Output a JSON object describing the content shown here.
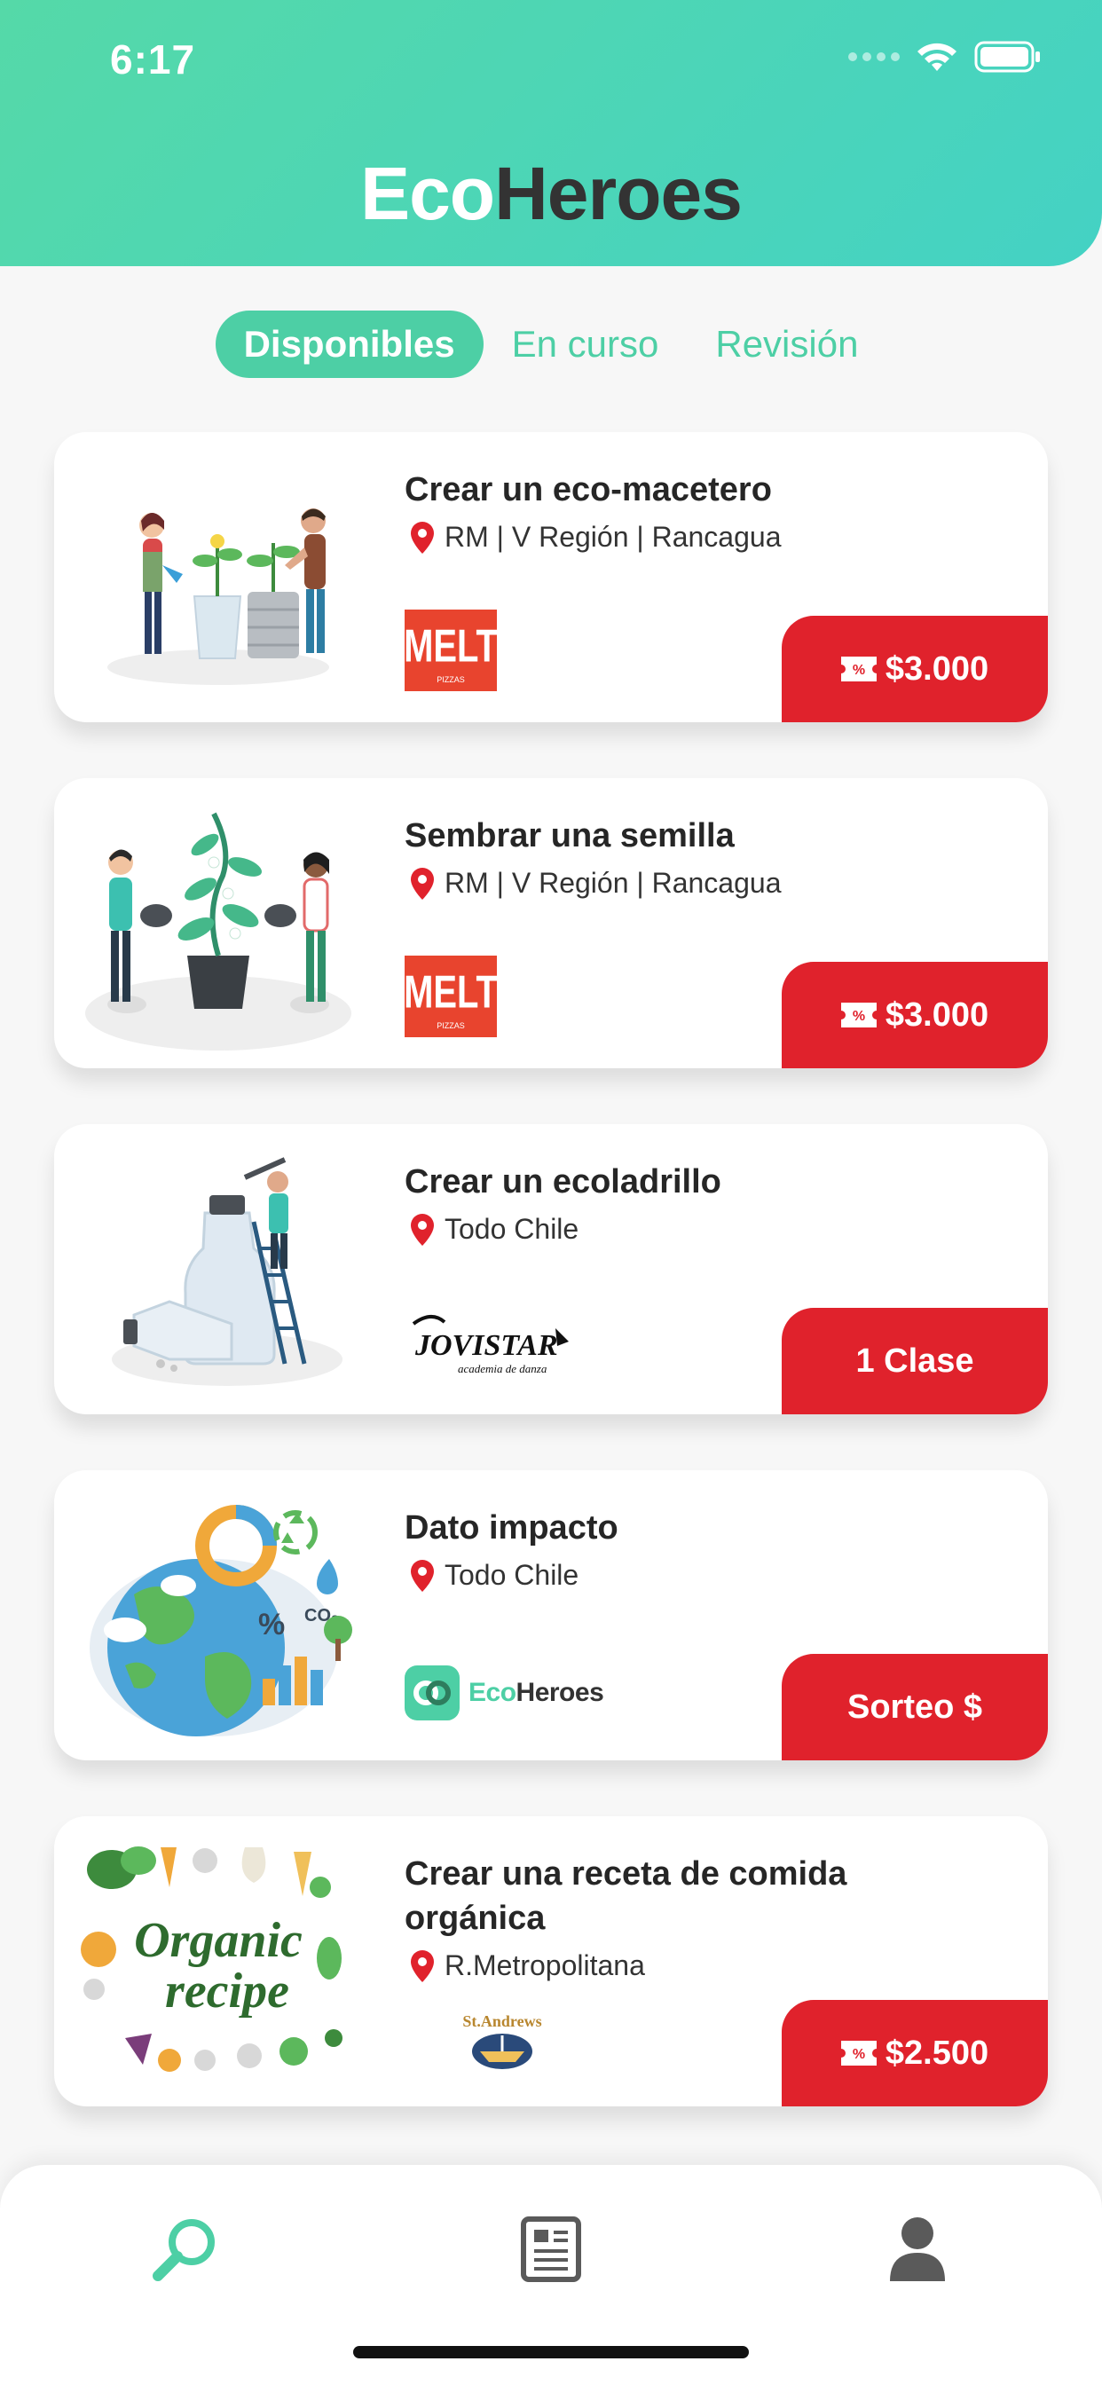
{
  "status_bar": {
    "time": "6:17"
  },
  "header": {
    "title_part1": "Eco",
    "title_part2": "Heroes"
  },
  "tabs": [
    {
      "label": "Disponibles",
      "active": true
    },
    {
      "label": "En curso",
      "active": false
    },
    {
      "label": "Revisión",
      "active": false
    }
  ],
  "cards": [
    {
      "title": "Crear un eco-macetero",
      "location": "RM | V Región | Rancagua",
      "brand": "MELT",
      "brand_sub": "PIZZAS",
      "reward": "$3.000",
      "reward_icon": "discount-ticket-icon",
      "illustration": "planting-pots-illustration"
    },
    {
      "title": "Sembrar una semilla",
      "location": "RM | V Región | Rancagua",
      "brand": "MELT",
      "brand_sub": "PIZZAS",
      "reward": "$3.000",
      "reward_icon": "discount-ticket-icon",
      "illustration": "growing-plant-illustration"
    },
    {
      "title": "Crear un ecoladrillo",
      "location": "Todo Chile",
      "brand": "JOVISTAR",
      "brand_sub": "academia de danza",
      "reward": "1 Clase",
      "illustration": "eco-brick-bottle-illustration"
    },
    {
      "title": "Dato impacto",
      "location": "Todo Chile",
      "brand": "EcoHeroes",
      "brand_part1": "Eco",
      "brand_part2": "Heroes",
      "reward": "Sorteo $",
      "illustration": "earth-data-illustration"
    },
    {
      "title": "Crear una receta de comida orgánica",
      "location": "R.Metropolitana",
      "brand": "St.Andrews",
      "reward": "$2.500",
      "reward_icon": "discount-ticket-icon",
      "illustration": "organic-recipe-illustration",
      "illustration_text_line1": "Organic",
      "illustration_text_line2": "recipe"
    }
  ],
  "bottom_nav": [
    {
      "icon": "search-icon",
      "active": true
    },
    {
      "icon": "news-icon",
      "active": false
    },
    {
      "icon": "profile-icon",
      "active": false
    }
  ],
  "colors": {
    "accent": "#4dcfa5",
    "reward": "#e0222c",
    "brand_melt": "#e8442e",
    "pin": "#e0222c"
  }
}
